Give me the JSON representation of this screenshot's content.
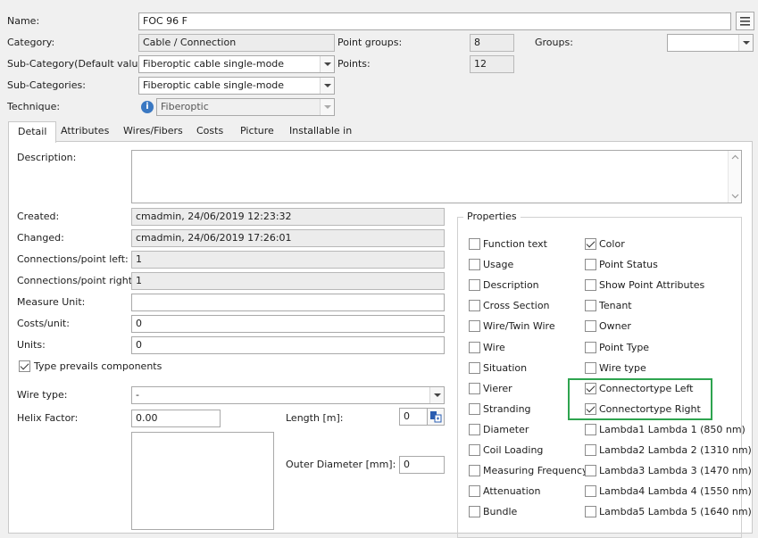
{
  "header": {
    "name_label": "Name:",
    "name_value": "FOC 96 F",
    "category_label": "Category:",
    "category_value": "Cable / Connection",
    "point_groups_label": "Point groups:",
    "point_groups_value": "8",
    "groups_label": "Groups:",
    "groups_value": "",
    "subcategory_default_label": "Sub-Category(Default value):",
    "subcategory_default_value": "Fiberoptic cable single-mode",
    "points_label": "Points:",
    "points_value": "12",
    "subcategories_label": "Sub-Categories:",
    "subcategories_value": "Fiberoptic cable single-mode",
    "technique_label": "Technique:",
    "technique_value": "Fiberoptic"
  },
  "tabs": [
    "Detail",
    "Attributes",
    "Wires/Fibers",
    "Costs",
    "Picture",
    "Installable in"
  ],
  "detail": {
    "description_label": "Description:",
    "description_value": "",
    "created_label": "Created:",
    "created_value": "cmadmin, 24/06/2019 12:23:32",
    "changed_label": "Changed:",
    "changed_value": "cmadmin, 24/06/2019 17:26:01",
    "conn_left_label": "Connections/point left:",
    "conn_left_value": "1",
    "conn_right_label": "Connections/point right:",
    "conn_right_value": "1",
    "measure_unit_label": "Measure Unit:",
    "measure_unit_value": "",
    "costs_unit_label": "Costs/unit:",
    "costs_unit_value": "0",
    "units_label": "Units:",
    "units_value": "0",
    "type_prevails_label": "Type prevails components",
    "type_prevails_checked": true,
    "wire_type_label": "Wire type:",
    "wire_type_value": "-",
    "helix_label": "Helix Factor:",
    "helix_value": "0.00",
    "length_label": "Length [m]:",
    "length_value": "0",
    "outer_diameter_label": "Outer Diameter [mm]:",
    "outer_diameter_value": "0"
  },
  "properties": {
    "title": "Properties",
    "left": [
      {
        "label": "Function text",
        "checked": false
      },
      {
        "label": "Usage",
        "checked": false
      },
      {
        "label": "Description",
        "checked": false
      },
      {
        "label": "Cross Section",
        "checked": false
      },
      {
        "label": "Wire/Twin Wire",
        "checked": false
      },
      {
        "label": "Wire",
        "checked": false
      },
      {
        "label": "Situation",
        "checked": false
      },
      {
        "label": "Vierer",
        "checked": false
      },
      {
        "label": "Stranding",
        "checked": false
      },
      {
        "label": "Diameter",
        "checked": false
      },
      {
        "label": "Coil Loading",
        "checked": false
      },
      {
        "label": "Measuring Frequency",
        "checked": false
      },
      {
        "label": "Attenuation",
        "checked": false
      },
      {
        "label": "Bundle",
        "checked": false
      }
    ],
    "right": [
      {
        "label": "Color",
        "checked": true
      },
      {
        "label": "Point Status",
        "checked": false
      },
      {
        "label": "Show Point Attributes",
        "checked": false
      },
      {
        "label": "Tenant",
        "checked": false
      },
      {
        "label": "Owner",
        "checked": false
      },
      {
        "label": "Point Type",
        "checked": false
      },
      {
        "label": "Wire type",
        "checked": false
      },
      {
        "label": "Connectortype Left",
        "checked": true
      },
      {
        "label": "Connectortype Right",
        "checked": true
      },
      {
        "label": "Lambda1 Lambda 1 (850 nm)",
        "checked": false
      },
      {
        "label": "Lambda2 Lambda 2 (1310 nm)",
        "checked": false
      },
      {
        "label": "Lambda3 Lambda 3 (1470 nm)",
        "checked": false
      },
      {
        "label": "Lambda4 Lambda 4 (1550 nm)",
        "checked": false
      },
      {
        "label": "Lambda5 Lambda 5 (1640 nm)",
        "checked": false
      }
    ]
  },
  "icons": {
    "menu": "hamburger-menu-icon",
    "info": "info-icon",
    "length_picker": "picker-icon"
  },
  "colors": {
    "highlight": "#2ea44f",
    "info_blue": "#3a78c2"
  }
}
